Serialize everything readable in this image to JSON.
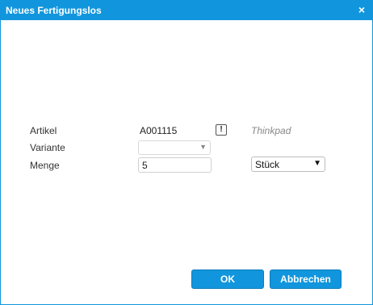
{
  "dialog": {
    "title": "Neues Fertigungslos",
    "close_glyph": "×"
  },
  "form": {
    "artikel_label": "Artikel",
    "artikel_value": "A001115",
    "info_glyph": "!",
    "artikel_name": "Thinkpad",
    "variante_label": "Variante",
    "variante_value": "",
    "menge_label": "Menge",
    "menge_value": "5",
    "unit_value": "Stück"
  },
  "buttons": {
    "ok_label": "OK",
    "cancel_label": "Abbrechen"
  },
  "colors": {
    "accent": "#1196dd",
    "hint_text": "#888888"
  },
  "icons": {
    "close": "close-icon",
    "info": "exclamation-icon",
    "dropdown": "chevron-down-icon"
  }
}
